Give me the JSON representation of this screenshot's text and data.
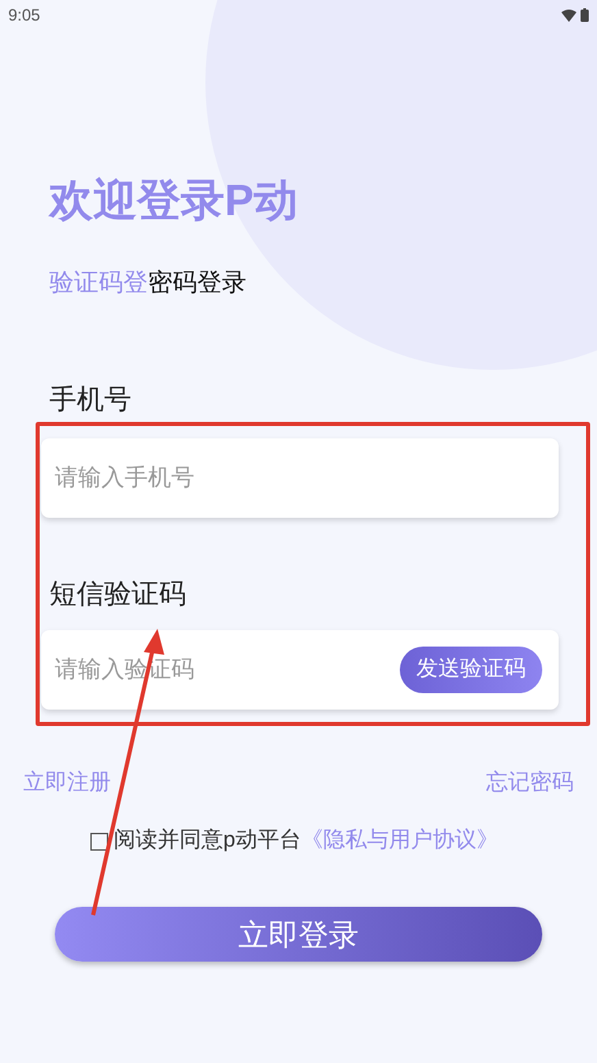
{
  "status_bar": {
    "time": "9:05"
  },
  "title": "欢迎登录P动",
  "tabs": [
    {
      "label": "验证码登",
      "selected": true
    },
    {
      "label": "密码登录",
      "selected": false
    }
  ],
  "fields": [
    {
      "label": "手机号",
      "placeholder": "请输入手机号"
    },
    {
      "label": "短信验证码",
      "placeholder": "请输入验证码",
      "button": "发送验证码"
    }
  ],
  "links": {
    "register": "立即注册",
    "forgot": "忘记密码"
  },
  "agreement": {
    "checked": false,
    "text": "阅读并同意p动平台",
    "link": "《隐私与用户协议》"
  },
  "login_button": "立即登录"
}
